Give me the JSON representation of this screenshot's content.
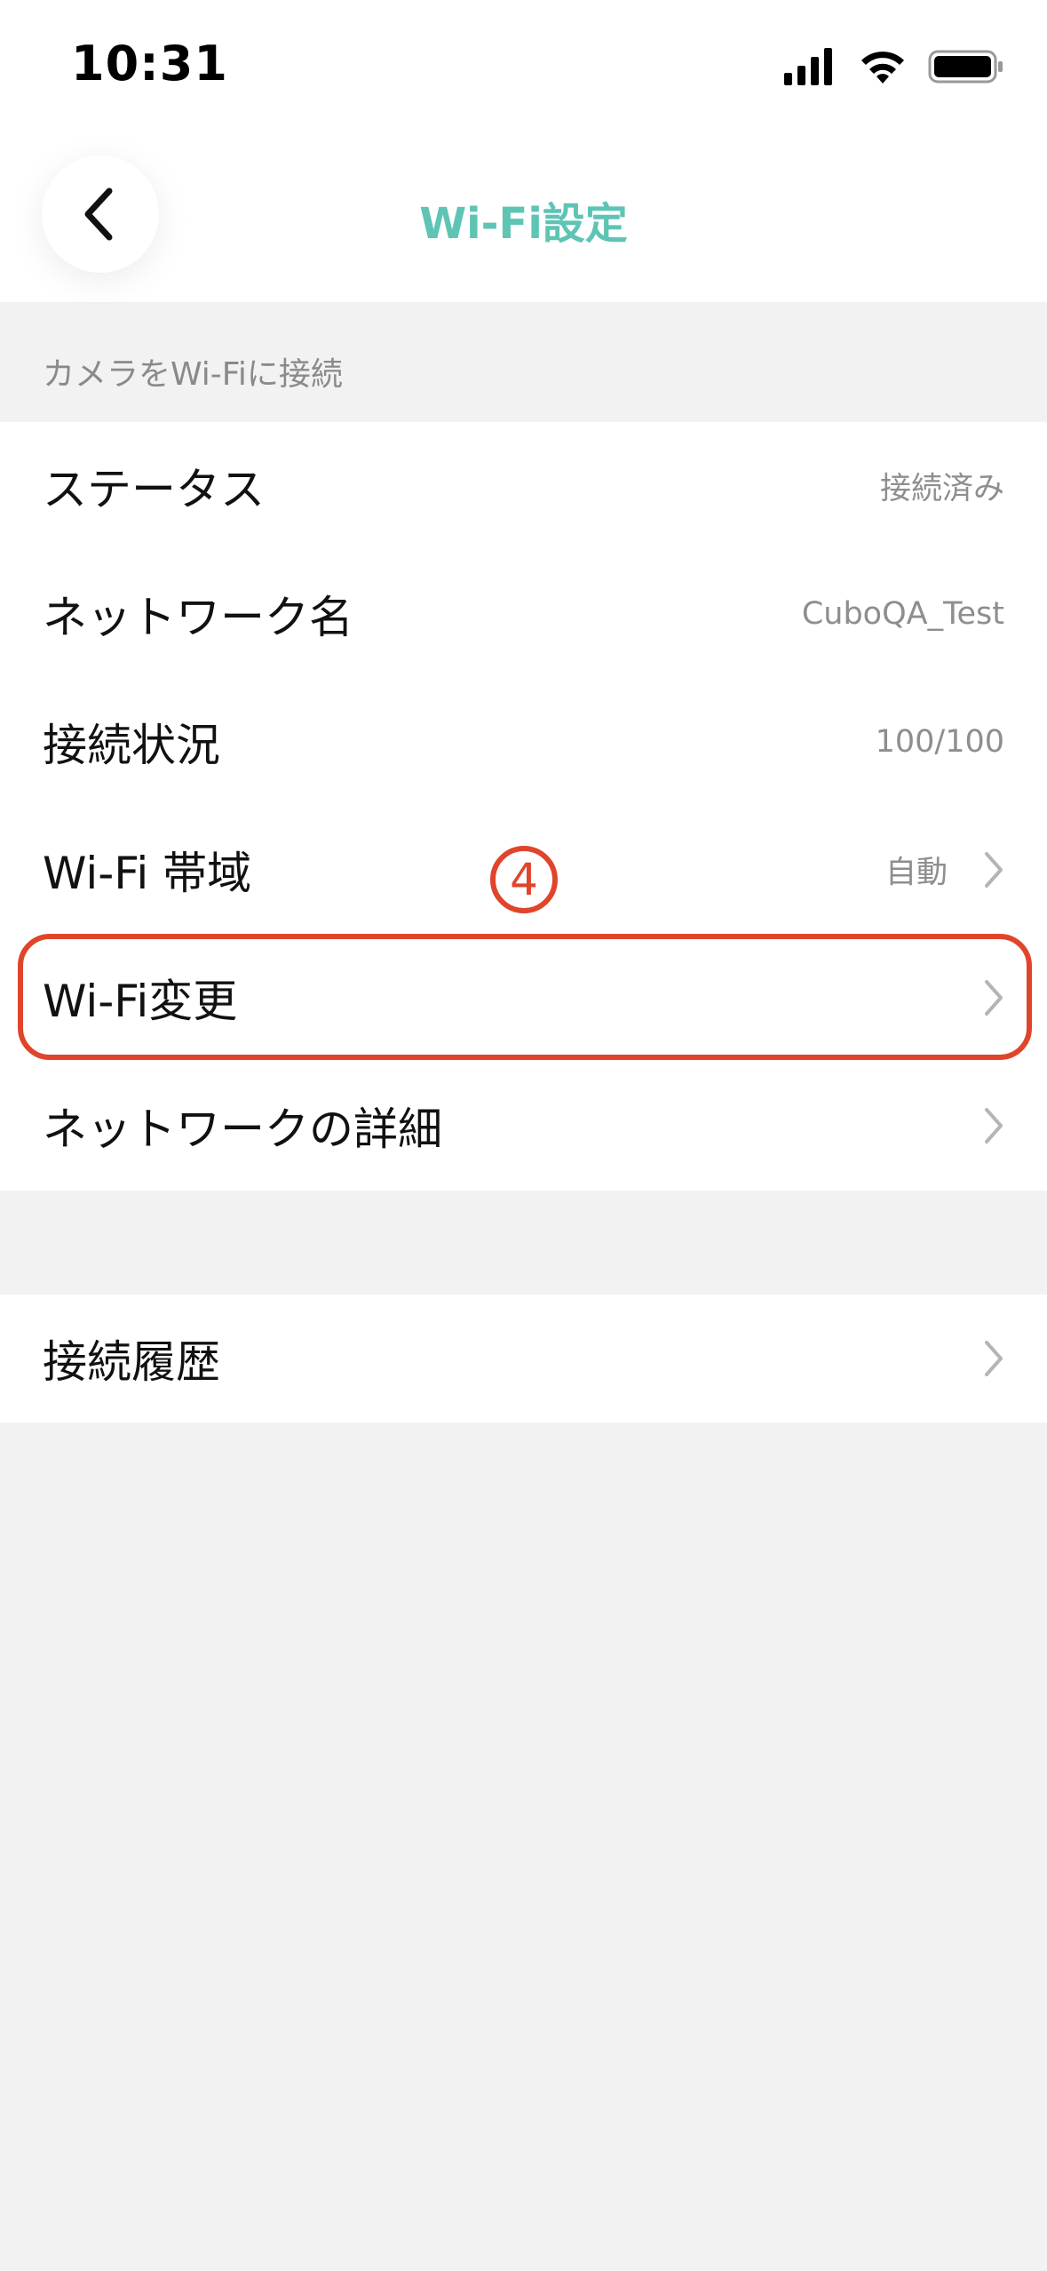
{
  "status_bar": {
    "time": "10:31"
  },
  "nav": {
    "title": "Wi-Fi設定",
    "back_icon": "chevron-left-icon",
    "accent_color": "#5ec4b4"
  },
  "section": {
    "header": "カメラをWi-Fiに接続"
  },
  "rows": [
    {
      "label": "ステータス",
      "value": "接続済み",
      "chevron": false
    },
    {
      "label": "ネットワーク名",
      "value": "CuboQA_Test",
      "chevron": false
    },
    {
      "label": "接続状況",
      "value": "100/100",
      "chevron": false
    },
    {
      "label": "Wi-Fi 帯域",
      "value": "自動",
      "chevron": true
    },
    {
      "label": "Wi-Fi変更",
      "value": "",
      "chevron": true
    },
    {
      "label": "ネットワークの詳細",
      "value": "",
      "chevron": true
    }
  ],
  "rows2": [
    {
      "label": "接続履歴",
      "value": "",
      "chevron": true
    }
  ],
  "annotation": {
    "number": "4",
    "color": "#e0452b"
  }
}
